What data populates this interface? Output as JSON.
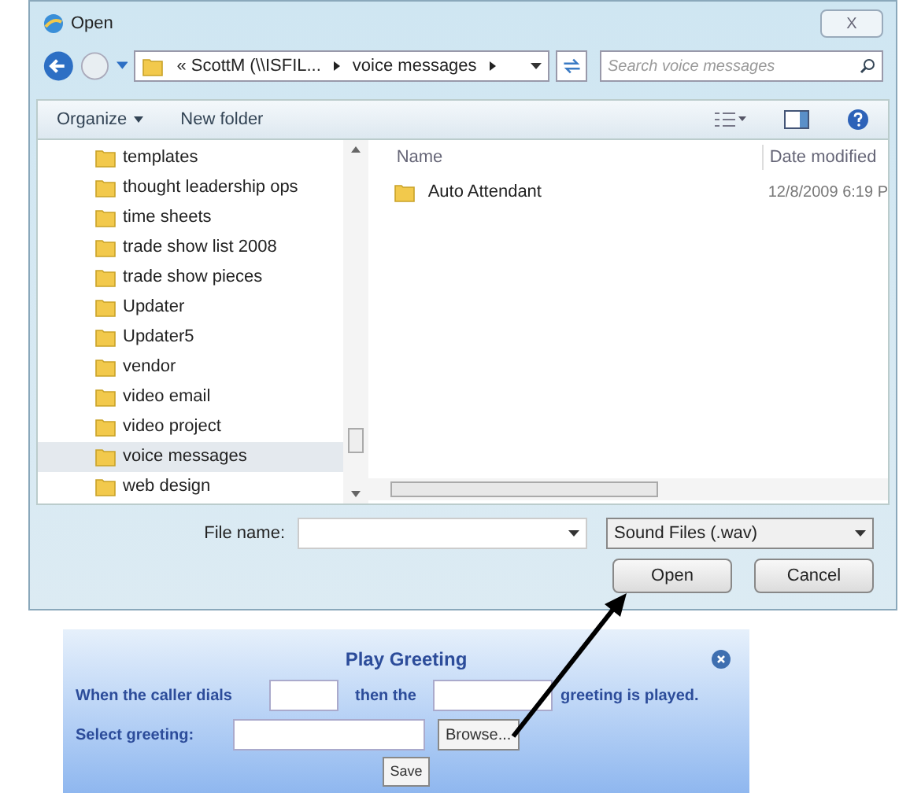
{
  "window": {
    "title": "Open",
    "close": "X"
  },
  "address": {
    "parts": [
      "« ScottM (\\\\ISFIL...",
      "voice messages"
    ],
    "search_placeholder": "Search voice messages"
  },
  "toolbar": {
    "organize": "Organize",
    "new_folder": "New folder"
  },
  "nav_items": [
    {
      "label": "templates",
      "selected": false
    },
    {
      "label": "thought leadership ops",
      "selected": false
    },
    {
      "label": "time sheets",
      "selected": false
    },
    {
      "label": "trade show list 2008",
      "selected": false
    },
    {
      "label": "trade show pieces",
      "selected": false
    },
    {
      "label": "Updater",
      "selected": false
    },
    {
      "label": "Updater5",
      "selected": false
    },
    {
      "label": "vendor",
      "selected": false
    },
    {
      "label": "video email",
      "selected": false
    },
    {
      "label": "video project",
      "selected": false
    },
    {
      "label": "voice messages",
      "selected": true
    },
    {
      "label": "web design",
      "selected": false
    }
  ],
  "file_list": {
    "columns": [
      "Name",
      "Date modified"
    ],
    "rows": [
      {
        "name": "Auto Attendant",
        "date": "12/8/2009 6:19 P"
      }
    ]
  },
  "footer": {
    "file_name_label": "File name:",
    "file_type": "Sound Files (.wav)",
    "open": "Open",
    "cancel": "Cancel"
  },
  "greeting_panel": {
    "title": "Play Greeting",
    "text_1": "When the caller dials",
    "text_2": "then the",
    "text_3": "greeting is played.",
    "select_label": "Select greeting:",
    "browse": "Browse...",
    "save": "Save"
  }
}
